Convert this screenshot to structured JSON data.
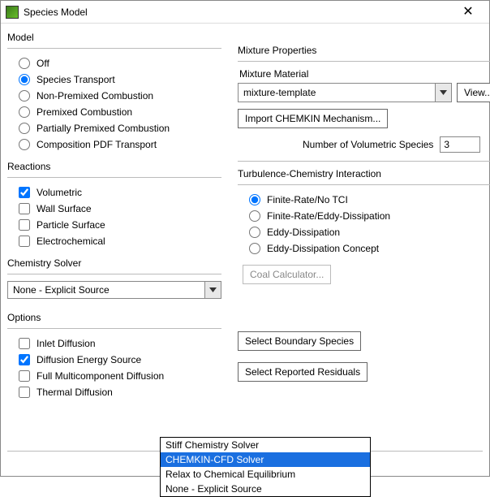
{
  "window": {
    "title": "Species Model"
  },
  "model": {
    "title": "Model",
    "options": {
      "off": "Off",
      "species_transport": "Species Transport",
      "non_premixed": "Non-Premixed Combustion",
      "premixed": "Premixed Combustion",
      "partially_premixed": "Partially Premixed Combustion",
      "composition_pdf": "Composition PDF Transport"
    }
  },
  "reactions": {
    "title": "Reactions",
    "options": {
      "volumetric": "Volumetric",
      "wall_surface": "Wall Surface",
      "particle_surface": "Particle Surface",
      "electrochemical": "Electrochemical"
    }
  },
  "chemistry_solver": {
    "title": "Chemistry Solver",
    "value": "None - Explicit Source",
    "options": {
      "stiff": "Stiff Chemistry Solver",
      "chemkin": "CHEMKIN-CFD Solver",
      "relax": "Relax to Chemical Equilibrium",
      "none": "None - Explicit Source"
    }
  },
  "options_group": {
    "title": "Options",
    "inlet_diffusion": "Inlet Diffusion",
    "diffusion_energy": "Diffusion Energy Source",
    "full_multi": "Full Multicomponent Diffusion",
    "thermal": "Thermal Diffusion"
  },
  "mixture": {
    "title": "Mixture Properties",
    "material_label": "Mixture Material",
    "material_value": "mixture-template",
    "view_btn": "View...",
    "import_btn": "Import CHEMKIN Mechanism...",
    "num_species_label": "Number of Volumetric Species",
    "num_species_value": "3"
  },
  "tci": {
    "title": "Turbulence-Chemistry Interaction",
    "options": {
      "finite_no_tci": "Finite-Rate/No TCI",
      "finite_eddy": "Finite-Rate/Eddy-Dissipation",
      "eddy": "Eddy-Dissipation",
      "eddy_concept": "Eddy-Dissipation Concept"
    },
    "coal_btn": "Coal Calculator..."
  },
  "right_buttons": {
    "boundary": "Select Boundary Species",
    "residuals": "Select Reported Residuals"
  }
}
